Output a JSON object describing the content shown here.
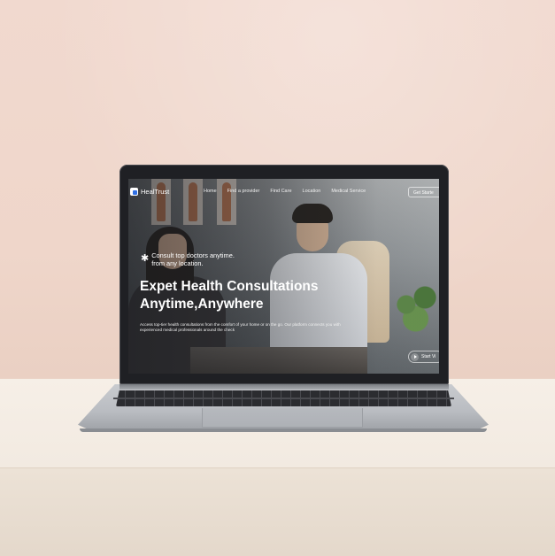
{
  "brand": {
    "name": "HealTrust"
  },
  "nav": {
    "items": [
      {
        "label": "Home"
      },
      {
        "label": "Find a provider"
      },
      {
        "label": "Find Care"
      },
      {
        "label": "Location"
      },
      {
        "label": "Medical Service"
      }
    ],
    "cta_label": "Get Starte"
  },
  "hero": {
    "tagline_line1": "Consult top doctors anytime.",
    "tagline_line2": "from any location.",
    "headline_line1": "Expet Health Consultations",
    "headline_line2": "Anytime,Anywhere",
    "body": "Access top-tier health consultations from the comfort of your home or on the go. Our platform connects you with experienced medical professionals around the check",
    "video_button_label": "Start Vi"
  },
  "icons": {
    "logo": "logo-mark-icon",
    "tagline": "sparkle-icon",
    "video": "play-icon"
  },
  "colors": {
    "brand_accent": "#2f6fe4",
    "text_on_hero": "#ffffff"
  }
}
